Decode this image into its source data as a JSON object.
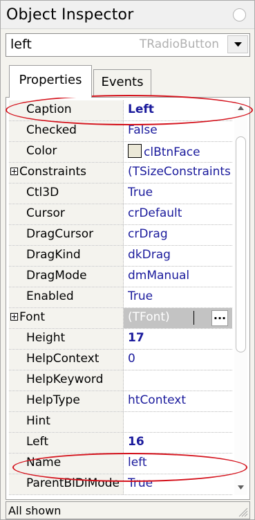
{
  "window": {
    "title": "Object Inspector"
  },
  "combo": {
    "object_name": "left",
    "object_type": "TRadioButton"
  },
  "tabs": [
    {
      "label": "Properties",
      "active": true
    },
    {
      "label": "Events",
      "active": false
    }
  ],
  "properties": [
    {
      "name": "Caption",
      "value": "Left",
      "bold": true
    },
    {
      "name": "Checked",
      "value": "False"
    },
    {
      "name": "Color",
      "value": "clBtnFace",
      "swatch": "#ece9d8"
    },
    {
      "name": "Constraints",
      "value": "(TSizeConstraints)",
      "expandable": true
    },
    {
      "name": "Ctl3D",
      "value": "True"
    },
    {
      "name": "Cursor",
      "value": "crDefault"
    },
    {
      "name": "DragCursor",
      "value": "crDrag"
    },
    {
      "name": "DragKind",
      "value": "dkDrag"
    },
    {
      "name": "DragMode",
      "value": "dmManual"
    },
    {
      "name": "Enabled",
      "value": "True"
    },
    {
      "name": "Font",
      "value": "(TFont)",
      "expandable": true,
      "editing": true
    },
    {
      "name": "Height",
      "value": "17",
      "bold": true
    },
    {
      "name": "HelpContext",
      "value": "0"
    },
    {
      "name": "HelpKeyword",
      "value": ""
    },
    {
      "name": "HelpType",
      "value": "htContext"
    },
    {
      "name": "Hint",
      "value": ""
    },
    {
      "name": "Left",
      "value": "16",
      "bold": true
    },
    {
      "name": "Name",
      "value": "left"
    },
    {
      "name": "ParentBiDiMode",
      "value": "True"
    }
  ],
  "font_editor": {
    "ellipsis_label": "..."
  },
  "statusbar": {
    "text": "All shown"
  },
  "colors": {
    "value_text": "#1a1a9c",
    "annotation": "#d4111b",
    "name_column_bg": "#f4f3ee"
  },
  "icons": {
    "title_button": "circle-icon",
    "dropdown": "chevron-down-icon",
    "expander": "plus-box-icon",
    "scroll_up": "triangle-up-icon",
    "scroll_down": "triangle-down-icon",
    "size_grip": "size-grip-icon"
  }
}
